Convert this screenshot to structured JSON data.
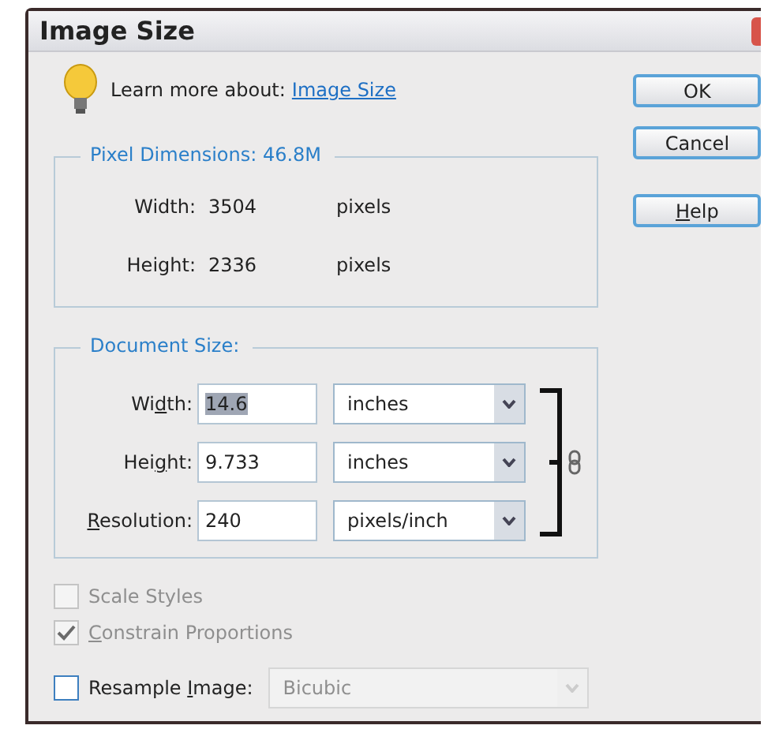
{
  "window": {
    "title": "Image Size"
  },
  "learn_more": {
    "text": "Learn more about:",
    "link": "Image Size"
  },
  "pixel_dimensions": {
    "title": "Pixel Dimensions:  46.8M",
    "rows": [
      {
        "label": "Width:",
        "value": "3504",
        "unit": "pixels"
      },
      {
        "label": "Height:",
        "value": "2336",
        "unit": "pixels"
      }
    ]
  },
  "document_size": {
    "title": "Document Size:",
    "rows": [
      {
        "label": {
          "pre": "Wi",
          "key": "d",
          "post": "th:"
        },
        "value": "14.6",
        "selected_text": true,
        "unit": "inches"
      },
      {
        "label": {
          "pre": "Hei",
          "key": "g",
          "post": "ht:"
        },
        "value": "9.733",
        "selected_text": false,
        "unit": "inches"
      },
      {
        "label": {
          "key": "R",
          "post": "esolution:"
        },
        "value": "240",
        "selected_text": false,
        "unit": "pixels/inch"
      }
    ],
    "linked": true
  },
  "options": [
    {
      "label": {
        "pre": "Scale Styles"
      },
      "checked": false,
      "disabled": true
    },
    {
      "label": {
        "key": "C",
        "post": "onstrain Proportions"
      },
      "checked": true,
      "disabled": true
    },
    {
      "label": {
        "pre": "Resample ",
        "key": "I",
        "post": "mage:"
      },
      "checked": false,
      "disabled": false,
      "dropdown": {
        "value": "Bicubic",
        "disabled": true
      }
    }
  ],
  "buttons": [
    {
      "label": {
        "pre": "OK"
      }
    },
    {
      "label": {
        "pre": "Cancel"
      }
    },
    {
      "label": {
        "key": "H",
        "post": "elp"
      }
    }
  ]
}
